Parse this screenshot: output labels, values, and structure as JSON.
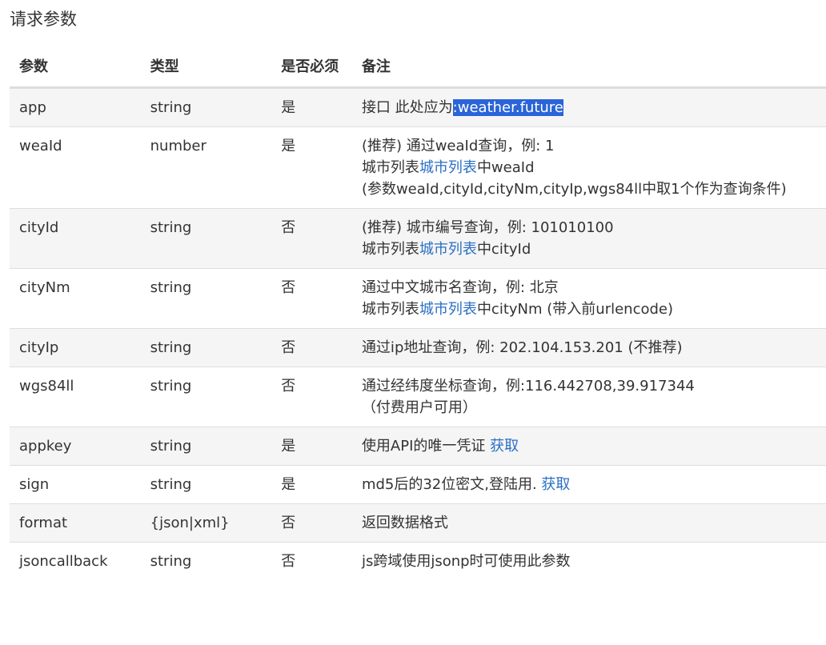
{
  "page_title": "请求参数",
  "headers": {
    "name": "参数",
    "type": "类型",
    "required": "是否必须",
    "note": "备注"
  },
  "rows": [
    {
      "name": "app",
      "type": "string",
      "required": "是",
      "lines": [
        {
          "text": "接口 此处应为",
          "highlight": ":weather.future"
        }
      ]
    },
    {
      "name": "weaId",
      "type": "number",
      "required": "是",
      "lines": [
        {
          "text": "(推荐) 通过weaId查询，例: 1"
        },
        {
          "pre": "城市列表",
          "link": "城市列表",
          "post": "中weaId"
        },
        {
          "text": "(参数weaId,cityId,cityNm,cityIp,wgs84ll中取1个作为查询条件)"
        }
      ]
    },
    {
      "name": "cityId",
      "type": "string",
      "required": "否",
      "lines": [
        {
          "text": "(推荐) 城市编号查询，例: 101010100"
        },
        {
          "pre": "城市列表",
          "link": "城市列表",
          "post": "中cityId"
        }
      ]
    },
    {
      "name": "cityNm",
      "type": "string",
      "required": "否",
      "lines": [
        {
          "text": "通过中文城市名查询，例: 北京"
        },
        {
          "pre": "城市列表",
          "link": "城市列表",
          "post": "中cityNm (带入前urlencode)"
        }
      ]
    },
    {
      "name": "cityIp",
      "type": "string",
      "required": "否",
      "lines": [
        {
          "text": "通过ip地址查询，例: 202.104.153.201 (不推荐)"
        }
      ]
    },
    {
      "name": "wgs84ll",
      "type": "string",
      "required": "否",
      "lines": [
        {
          "text": "通过经纬度坐标查询，例:116.442708,39.917344"
        },
        {
          "text": "（付费用户可用）"
        }
      ]
    },
    {
      "name": "appkey",
      "type": "string",
      "required": "是",
      "lines": [
        {
          "pre": "使用API的唯一凭证 ",
          "link": "获取",
          "post": ""
        }
      ]
    },
    {
      "name": "sign",
      "type": "string",
      "required": "是",
      "lines": [
        {
          "pre": "md5后的32位密文,登陆用. ",
          "link": "获取",
          "post": ""
        }
      ]
    },
    {
      "name": "format",
      "type": "{json|xml}",
      "required": "否",
      "lines": [
        {
          "text": "返回数据格式"
        }
      ]
    },
    {
      "name": "jsoncallback",
      "type": "string",
      "required": "否",
      "lines": [
        {
          "text": "js跨域使用jsonp时可使用此参数"
        }
      ]
    }
  ]
}
